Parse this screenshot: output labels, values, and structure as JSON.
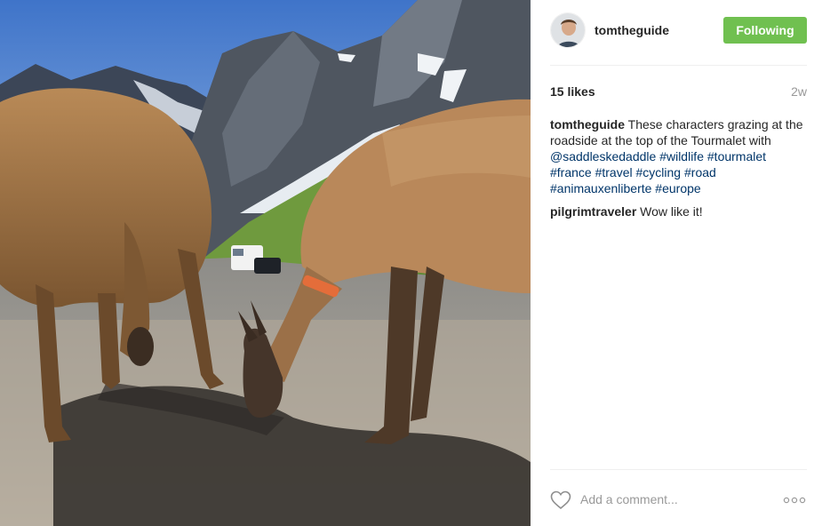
{
  "post": {
    "image_alt": "Two llamas grazing at the roadside at the top of the Tourmalet",
    "author": {
      "username": "tomtheguide",
      "follow_label": "Following",
      "follow_color": "#70c050"
    },
    "likes": "15 likes",
    "age": "2w",
    "caption": {
      "username": "tomtheguide",
      "text": "These characters grazing at the roadside at the top of the Tourmalet with ",
      "mention": "@saddleskedaddle",
      "hashtags": [
        "#wildlife",
        "#tourmalet",
        "#france",
        "#travel",
        "#cycling",
        "#road",
        "#animauxenliberte",
        "#europe"
      ]
    },
    "comments": [
      {
        "username": "pilgrimtraveler",
        "text": "Wow like it!"
      }
    ],
    "comment_input": {
      "placeholder": "Add a comment..."
    },
    "icons": {
      "like": "heart-icon",
      "more": "more-options-icon"
    },
    "colors": {
      "link": "#003569",
      "muted": "#999999",
      "divider": "#efefef"
    }
  }
}
